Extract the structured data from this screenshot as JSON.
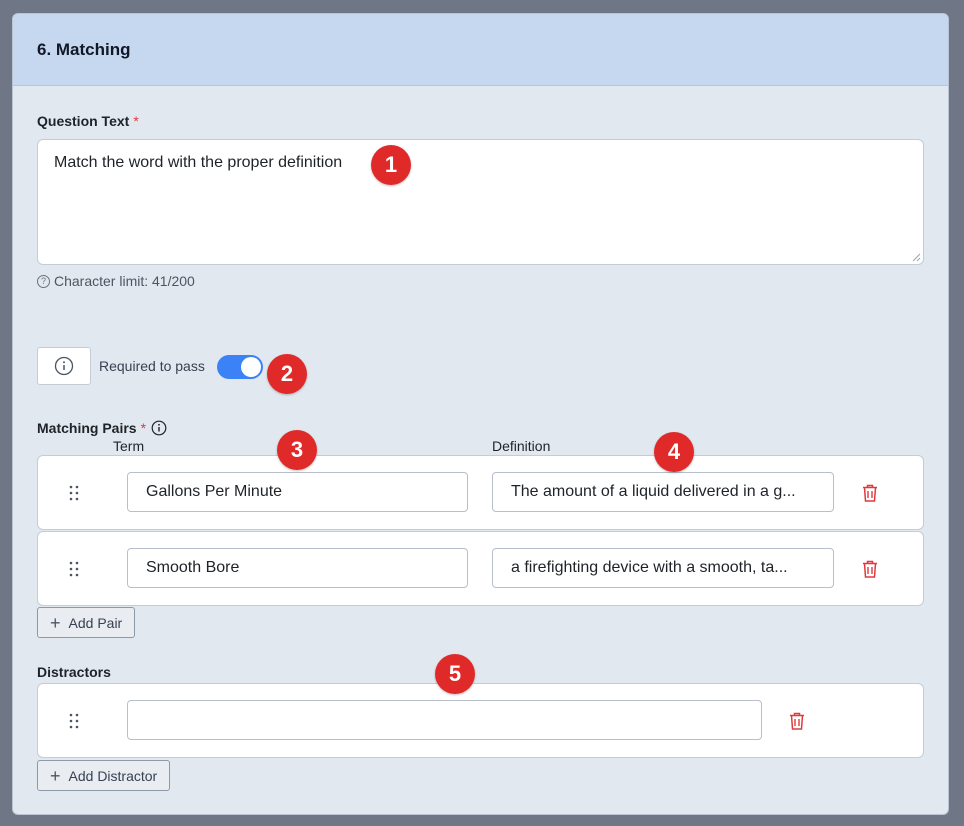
{
  "section": {
    "title": "6. Matching"
  },
  "question": {
    "label": "Question Text",
    "required_marker": "*",
    "value": "Match the word with the proper definition",
    "char_limit": "Character limit: 41/200"
  },
  "required_to_pass": {
    "label": "Required to pass",
    "enabled": true
  },
  "matching_pairs": {
    "label": "Matching Pairs",
    "required_marker": "*",
    "term_header": "Term",
    "definition_header": "Definition",
    "pairs": [
      {
        "term": "Gallons Per Minute",
        "definition": "The amount of a liquid delivered in a g..."
      },
      {
        "term": "Smooth Bore",
        "definition": "a firefighting device with a smooth, ta..."
      }
    ],
    "add_label": "Add Pair"
  },
  "distractors": {
    "label": "Distractors",
    "items": [
      {
        "value": ""
      }
    ],
    "add_label": "Add Distractor"
  },
  "annotations": [
    "1",
    "2",
    "3",
    "4",
    "5"
  ],
  "colors": {
    "accent": "#3b82f6",
    "danger": "#e02a2a",
    "header_bg": "#c6d7f0",
    "card_bg": "#e2e8f0"
  }
}
